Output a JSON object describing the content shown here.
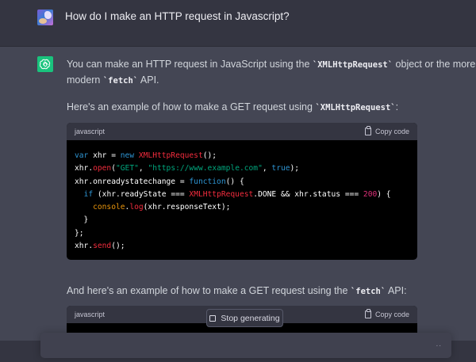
{
  "conversation": {
    "user_message": "How do I make an HTTP request in Javascript?",
    "assistant": {
      "intro": {
        "pre": "You can make an HTTP request in JavaScript using the ",
        "code1": "`XMLHttpRequest`",
        "mid": " object or the more",
        "line2_pre": "modern ",
        "code2": "`fetch`",
        "line2_post": " API."
      },
      "example1": {
        "pre": "Here's an example of how to make a GET request using ",
        "code": "`XMLHttpRequest`",
        "post": ":"
      },
      "example2": {
        "pre": "And here's an example of how to make a GET request using the ",
        "code": "`fetch`",
        "post": " API:"
      }
    }
  },
  "code_blocks": [
    {
      "language": "javascript",
      "copy_label": "Copy code",
      "lines": [
        [
          {
            "t": "var",
            "c": "kw"
          },
          {
            "t": " xhr = "
          },
          {
            "t": "new",
            "c": "kw"
          },
          {
            "t": " "
          },
          {
            "t": "XMLHttpRequest",
            "c": "cls"
          },
          {
            "t": "();"
          }
        ],
        [
          {
            "t": "xhr."
          },
          {
            "t": "open",
            "c": "fn"
          },
          {
            "t": "("
          },
          {
            "t": "\"GET\"",
            "c": "str"
          },
          {
            "t": ", "
          },
          {
            "t": "\"https://www.example.com\"",
            "c": "str"
          },
          {
            "t": ", "
          },
          {
            "t": "true",
            "c": "kw"
          },
          {
            "t": ");"
          }
        ],
        [
          {
            "t": "xhr.onreadystatechange = "
          },
          {
            "t": "function",
            "c": "kw"
          },
          {
            "t": "() {"
          }
        ],
        [
          {
            "t": "  "
          },
          {
            "t": "if",
            "c": "kw"
          },
          {
            "t": " (xhr.readyState === "
          },
          {
            "t": "XMLHttpRequest",
            "c": "cls"
          },
          {
            "t": ".DONE && xhr.status === "
          },
          {
            "t": "200",
            "c": "num"
          },
          {
            "t": ") {"
          }
        ],
        [
          {
            "t": "    "
          },
          {
            "t": "console",
            "c": "cn"
          },
          {
            "t": "."
          },
          {
            "t": "log",
            "c": "fn"
          },
          {
            "t": "(xhr.responseText);"
          }
        ],
        [
          {
            "t": "  }"
          }
        ],
        [
          {
            "t": "};"
          }
        ],
        [
          {
            "t": "xhr."
          },
          {
            "t": "send",
            "c": "fn"
          },
          {
            "t": "();"
          }
        ]
      ]
    },
    {
      "language": "javascript",
      "copy_label": "Copy code",
      "lines": []
    }
  ],
  "controls": {
    "stop_label": "Stop generating",
    "composer_dots": ".."
  }
}
